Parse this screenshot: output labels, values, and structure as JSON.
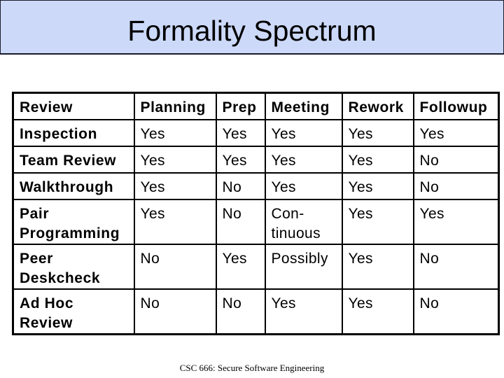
{
  "slide": {
    "title": "Formality Spectrum",
    "footer": "CSC 666: Secure Software Engineering",
    "title_bar_color": "#ccd9f9"
  },
  "table": {
    "headers": [
      "Review",
      "Planning",
      "Prep",
      "Meeting",
      "Rework",
      "Followup"
    ],
    "rows": [
      {
        "review": "Inspection",
        "planning": "Yes",
        "prep": "Yes",
        "meeting": "Yes",
        "rework": "Yes",
        "followup": "Yes"
      },
      {
        "review": "Team Review",
        "planning": "Yes",
        "prep": "Yes",
        "meeting": "Yes",
        "rework": "Yes",
        "followup": "No"
      },
      {
        "review": "Walkthrough",
        "planning": "Yes",
        "prep": "No",
        "meeting": "Yes",
        "rework": "Yes",
        "followup": "No"
      },
      {
        "review": "Pair Programming",
        "planning": "Yes",
        "prep": "No",
        "meeting": "Con-tinuous",
        "rework": "Yes",
        "followup": "Yes"
      },
      {
        "review": "Peer Deskcheck",
        "planning": "No",
        "prep": "Yes",
        "meeting": "Possibly",
        "rework": "Yes",
        "followup": "No"
      },
      {
        "review": "Ad Hoc Review",
        "planning": "No",
        "prep": "No",
        "meeting": "Yes",
        "rework": "Yes",
        "followup": "No"
      }
    ]
  }
}
